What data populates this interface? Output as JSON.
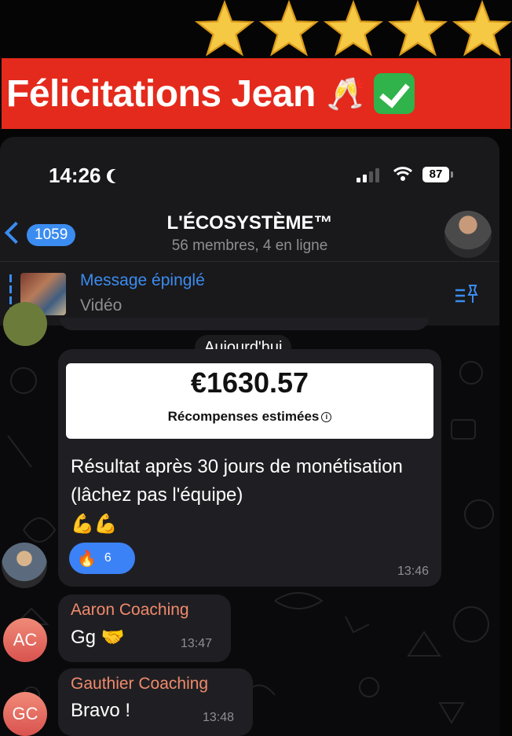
{
  "banner": {
    "title": "Félicitations Jean",
    "emoji_champagne": "🥂",
    "icon_check": "check-mark-icon",
    "stars_count": 5,
    "star_color": "#f6c945"
  },
  "status_bar": {
    "time": "14:26",
    "battery": "87"
  },
  "header": {
    "back_count": "1059",
    "title": "L'ÉCOSYSTÈME™",
    "subtitle": "56 membres, 4 en ligne"
  },
  "pinned": {
    "title": "Message épinglé",
    "subtitle": "Vidéo"
  },
  "chat": {
    "date_label": "Aujourd'hui",
    "earnings_message": {
      "amount": "€1630.57",
      "amount_label": "Récompenses estimées",
      "text": "Résultat après 30 jours de monétisation (lâchez pas l'équipe)",
      "emoji": "💪💪",
      "reaction_emoji": "🔥",
      "reaction_count": "6",
      "time": "13:46"
    },
    "messages": [
      {
        "initials": "AC",
        "sender": "Aaron Coaching",
        "text": "Gg 🤝",
        "time": "13:47"
      },
      {
        "initials": "GC",
        "sender": "Gauthier Coaching",
        "text": "Bravo !",
        "time": "13:48"
      }
    ]
  },
  "colors": {
    "accent": "#3b8cf0",
    "banner_red": "#e42a1c",
    "sender_name": "#f08a6b"
  }
}
